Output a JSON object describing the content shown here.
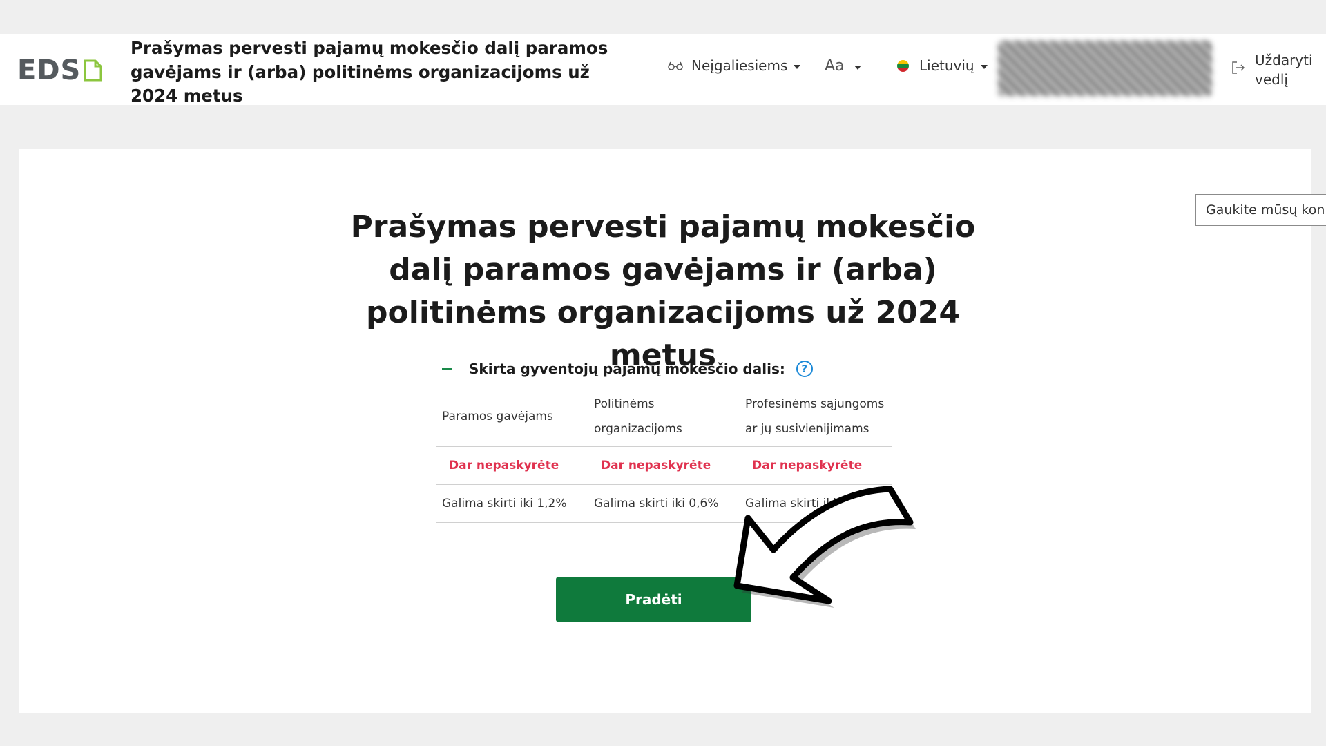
{
  "header": {
    "logo_text": "EDS",
    "title": "Prašymas pervesti pajamų mokesčio dalį paramos gavėjams ir (arba) politinėms organizacijoms už 2024 metus",
    "accessibility_label": "Neįgaliesiems",
    "font_size_label": "Aa",
    "language_label": "Lietuvių",
    "close_guide_label": "Uždaryti vedlį"
  },
  "contact_tab_label": "Gaukite mūsų kon",
  "main": {
    "title": "Prašymas pervesti pajamų mokesčio dalį paramos gavėjams ir (arba) politinėms organizacijoms už 2024 metus",
    "section_label": "Skirta gyventojų pajamų mokesčio dalis:",
    "help_symbol": "?",
    "table": {
      "headers": [
        "Paramos gavėjams",
        "Politinėms organizacijoms",
        "Profesinėms sąjungoms ar jų susivienijimams"
      ],
      "status_row": [
        "Dar nepaskyrėte",
        "Dar nepaskyrėte",
        "Dar nepaskyrėte"
      ],
      "limit_row": [
        "Galima skirti iki 1,2%",
        "Galima skirti iki 0,6%",
        "Galima skirti iki 1%"
      ]
    },
    "start_button_label": "Pradėti"
  },
  "colors": {
    "accent_green": "#0f7a3c",
    "status_red": "#e0324f",
    "help_blue": "#1c8ad8"
  },
  "icons": [
    "glasses-icon",
    "caret-down-icon",
    "lithuania-flag-icon",
    "logout-icon",
    "help-icon",
    "document-icon",
    "curved-arrow-icon"
  ]
}
